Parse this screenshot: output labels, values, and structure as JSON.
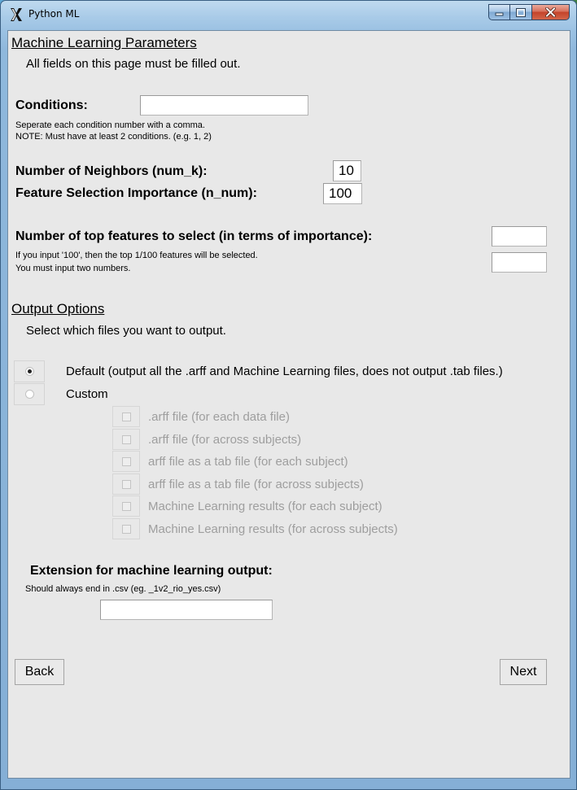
{
  "window": {
    "title": "Python ML",
    "controls": {
      "minimize": "minimize-icon",
      "maximize": "maximize-icon",
      "close": "close-icon"
    }
  },
  "ml_params": {
    "title": "Machine Learning Parameters",
    "subtitle": "All fields on this page must be filled out.",
    "conditions": {
      "label": "Conditions:",
      "value": "",
      "hint1": "Seperate each condition number with a comma.",
      "hint2": "NOTE: Must have at least 2 conditions. (e.g. 1, 2)"
    },
    "neighbors": {
      "label": "Number of Neighbors (num_k):",
      "value": "10"
    },
    "importance": {
      "label": "Feature Selection Importance (n_num):",
      "value": "100"
    },
    "top_features": {
      "label": "Number of top features to select (in terms of importance):",
      "hint1": "If you input '100', then the top 1/100 features will be selected.",
      "hint2": "You must input two numbers.",
      "value1": "",
      "value2": ""
    }
  },
  "output_options": {
    "title": "Output Options",
    "subtitle": "Select which files you want to output.",
    "default_label": "Default (output all the .arff and Machine Learning files, does not output .tab files.)",
    "custom_label": "Custom",
    "selected": "default",
    "checkboxes": [
      ".arff file  (for each data file)",
      ".arff file (for across subjects)",
      "arff file as a tab file (for each subject)",
      "arff file as a tab file (for across subjects)",
      "Machine Learning results (for each subject)",
      "Machine Learning results (for across subjects)"
    ]
  },
  "extension": {
    "label": "Extension for machine learning output:",
    "hint": "Should always end in .csv (eg. _1v2_rio_yes.csv)",
    "value": ""
  },
  "buttons": {
    "back": "Back",
    "next": "Next"
  }
}
